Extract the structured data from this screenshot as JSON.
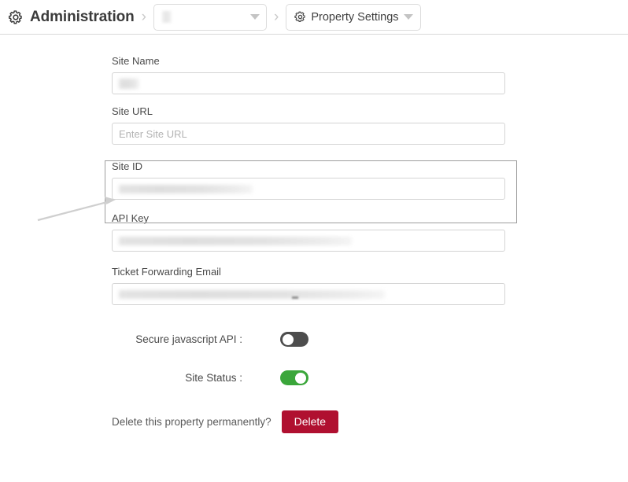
{
  "header": {
    "root": {
      "icon": "gear-icon",
      "label": "Administration"
    },
    "separator": "›",
    "property_select": {
      "value": "",
      "redacted": true,
      "caret_icon": "chevron-down-icon"
    },
    "settings_button": {
      "icon": "gear-icon",
      "label": "Property Settings",
      "caret_icon": "chevron-down-icon"
    }
  },
  "form": {
    "fields": [
      {
        "label": "Site Name",
        "value": "",
        "placeholder": "",
        "redacted": true
      },
      {
        "label": "Site URL",
        "value": "",
        "placeholder": "Enter Site URL",
        "redacted": false
      },
      {
        "label": "Site ID",
        "value": "",
        "placeholder": "",
        "redacted": true,
        "highlighted": true
      },
      {
        "label": "API Key",
        "value": "",
        "placeholder": "",
        "redacted": true
      },
      {
        "label": "Ticket Forwarding Email",
        "value": "",
        "placeholder": "",
        "redacted": true
      }
    ],
    "toggles": [
      {
        "label": "Secure javascript API :",
        "state": "off"
      },
      {
        "label": "Site Status :",
        "state": "on"
      }
    ],
    "delete": {
      "prompt": "Delete this property permanently?",
      "button_label": "Delete"
    }
  },
  "annotation": {
    "type": "arrow",
    "target": "Site ID"
  },
  "colors": {
    "delete_button": "#b01030",
    "toggle_on": "#3aa63a",
    "toggle_off": "#4d4d4d",
    "border": "#d4d4d4",
    "highlight_border": "#9d9d9d",
    "arrow": "#cfcfcf"
  }
}
